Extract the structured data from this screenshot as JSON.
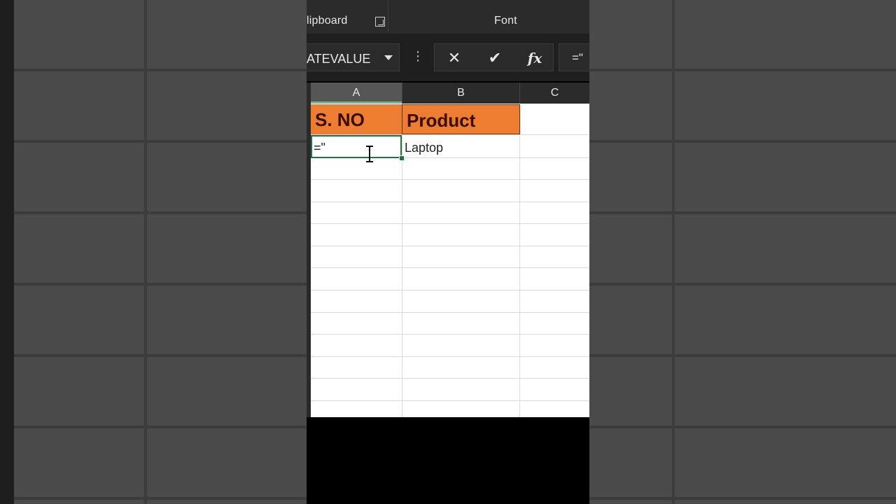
{
  "ribbon": {
    "clipboard_label": "lipboard",
    "font_label": "Font"
  },
  "formula_bar": {
    "name_box_value": "ATEVALUE",
    "cancel_symbol": "✕",
    "enter_symbol": "✔",
    "fx_symbol": "fx",
    "more_symbol": "⋮",
    "formula_value": "=\""
  },
  "columns": [
    "A",
    "B",
    "C"
  ],
  "cells": {
    "A1": "S. NO",
    "B1": "Product",
    "A2": "=\"",
    "B2": "Laptop"
  },
  "colors": {
    "header_fill": "#ed7d31",
    "selection": "#217346"
  }
}
